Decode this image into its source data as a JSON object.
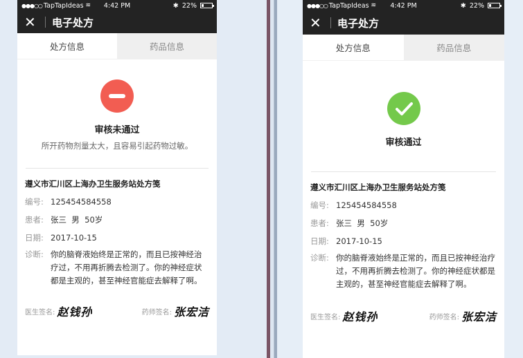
{
  "screens": [
    {
      "status_bar": {
        "carrier": "TapTapIdeas",
        "time": "4:42 PM",
        "battery": "22%",
        "battery_level": 0.22
      },
      "nav": {
        "title": "电子处方"
      },
      "tabs": [
        {
          "label": "处方信息"
        },
        {
          "label": "药品信息"
        }
      ],
      "review": {
        "title": "审核未通过",
        "reason": "所开药物剂量太大，且容易引起药物过敏。"
      },
      "prescription": {
        "clinic": "遵义市汇川区上海办卫生服务站处方笺",
        "id_label": "编号:",
        "id": "125454584558",
        "patient_label": "患者:",
        "patient": "张三  男  50岁",
        "date_label": "日期:",
        "date": "2017-10-15",
        "diagnosis_label": "诊断:",
        "diagnosis": "你的脑脊液始终是正常的，而且已按神经治疗过，不用再折腾去检测了。你的神经症状都是主观的，甚至神经官能症去解释了啊。"
      },
      "signatures": {
        "doctor_label": "医生签名:",
        "doctor": "赵钱孙",
        "pharmacist_label": "药师签名:",
        "pharmacist": "张宏洁"
      }
    },
    {
      "status_bar": {
        "carrier": "TapTapIdeas",
        "time": "4:42 PM",
        "battery": "22%",
        "battery_level": 0.22
      },
      "nav": {
        "title": "电子处方"
      },
      "tabs": [
        {
          "label": "处方信息"
        },
        {
          "label": "药品信息"
        }
      ],
      "review": {
        "title": "审核通过"
      },
      "prescription": {
        "clinic": "遵义市汇川区上海办卫生服务站处方笺",
        "id_label": "编号:",
        "id": "125454584558",
        "patient_label": "患者:",
        "patient": "张三  男  50岁",
        "date_label": "日期:",
        "date": "2017-10-15",
        "diagnosis_label": "诊断:",
        "diagnosis": "你的脑脊液始终是正常的，而且已按神经治疗过，不用再折腾去检测了。你的神经症状都是主观的，甚至神经官能症去解释了啊。"
      },
      "signatures": {
        "doctor_label": "医生签名:",
        "doctor": "赵钱孙",
        "pharmacist_label": "药师签名:",
        "pharmacist": "张宏洁"
      }
    }
  ],
  "colors": {
    "fail": "#f25d52",
    "pass": "#74c94b",
    "navbar": "#232323"
  }
}
